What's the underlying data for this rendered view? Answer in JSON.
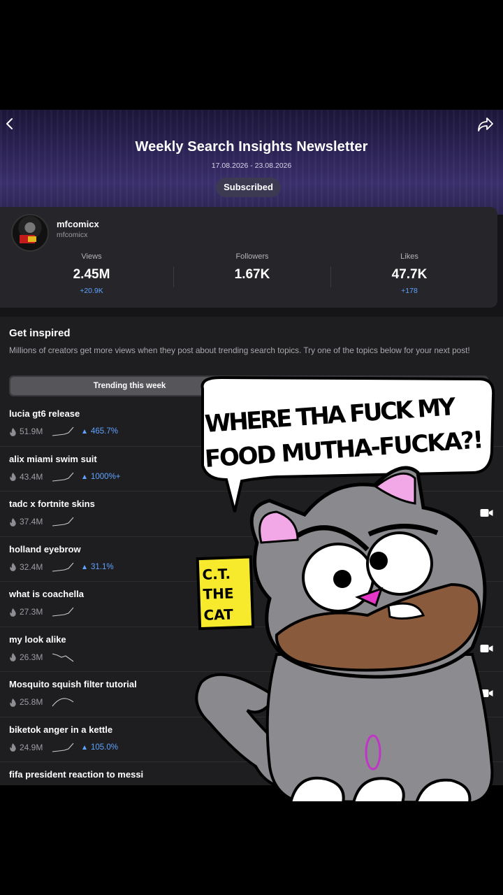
{
  "header": {
    "title": "Weekly Search Insights Newsletter",
    "date_range": "17.08.2026 - 23.08.2026",
    "subscribe_label": "Subscribed"
  },
  "profile": {
    "display_name": "mfcomicx",
    "username": "mfcomicx",
    "stats": [
      {
        "label": "Views",
        "value": "2.45M",
        "delta": "+20.9K"
      },
      {
        "label": "Followers",
        "value": "1.67K",
        "delta": ""
      },
      {
        "label": "Likes",
        "value": "47.7K",
        "delta": "+178"
      }
    ]
  },
  "inspire": {
    "heading": "Get inspired",
    "description": "Millions of creators get more views when they post about trending search topics. Try one of the topics below for your next post!",
    "tab_active": "Trending this week"
  },
  "trends": [
    {
      "name": "lucia gt6 release",
      "count": "51.9M",
      "growth": "465.7%",
      "trend": "up",
      "camera": false
    },
    {
      "name": "alix miami swim suit",
      "count": "43.4M",
      "growth": "1000%+",
      "trend": "up",
      "camera": false
    },
    {
      "name": "tadc x fortnite skins",
      "count": "37.4M",
      "growth": "",
      "trend": "up",
      "camera": true
    },
    {
      "name": "holland eyebrow",
      "count": "32.4M",
      "growth": "31.1%",
      "trend": "up",
      "camera": false
    },
    {
      "name": "what is coachella",
      "count": "27.3M",
      "growth": "",
      "trend": "up",
      "camera": false
    },
    {
      "name": "my look alike",
      "count": "26.3M",
      "growth": "",
      "trend": "down",
      "camera": true
    },
    {
      "name": "Mosquito squish filter tutorial",
      "count": "25.8M",
      "growth": "",
      "trend": "hill",
      "camera": true
    },
    {
      "name": "biketok anger in a kettle",
      "count": "24.9M",
      "growth": "105.0%",
      "trend": "up",
      "camera": false
    },
    {
      "name": "fifa president reaction to messi",
      "count": "",
      "growth": "",
      "trend": "up",
      "camera": false
    }
  ],
  "sticker": {
    "speech_text": "WHERE THA FUCK MY FOOD MUTHA-FUCKA?!",
    "sign_text": "C.T. THE CAT"
  },
  "colors": {
    "accent_blue": "#5fa3ff",
    "background": "#151517",
    "card": "#26262a"
  }
}
